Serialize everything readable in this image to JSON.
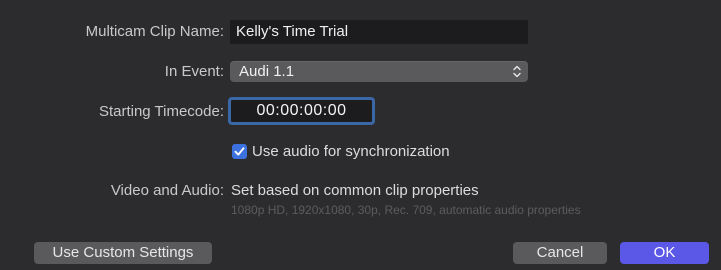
{
  "form": {
    "name_label": "Multicam Clip Name:",
    "name_value": "Kelly's Time Trial",
    "event_label": "In Event:",
    "event_value": "Audi 1.1",
    "timecode_label": "Starting Timecode:",
    "timecode_value": "00:00:00:00",
    "sync_checkbox_label": "Use audio for synchronization",
    "sync_checked": true,
    "va_label": "Video and Audio:",
    "va_value": "Set based on common clip properties",
    "va_details": "1080p HD, 1920x1080, 30p, Rec. 709, automatic audio properties"
  },
  "buttons": {
    "custom_label": "Use Custom Settings",
    "cancel_label": "Cancel",
    "ok_label": "OK"
  },
  "colors": {
    "background": "#2c2c2e",
    "accent": "#5b58e8",
    "focus_ring": "#3b67a6",
    "checkbox": "#3c71e0"
  },
  "icons": {
    "popup": "chevron-up-down-icon",
    "checkbox": "checkmark-icon"
  }
}
